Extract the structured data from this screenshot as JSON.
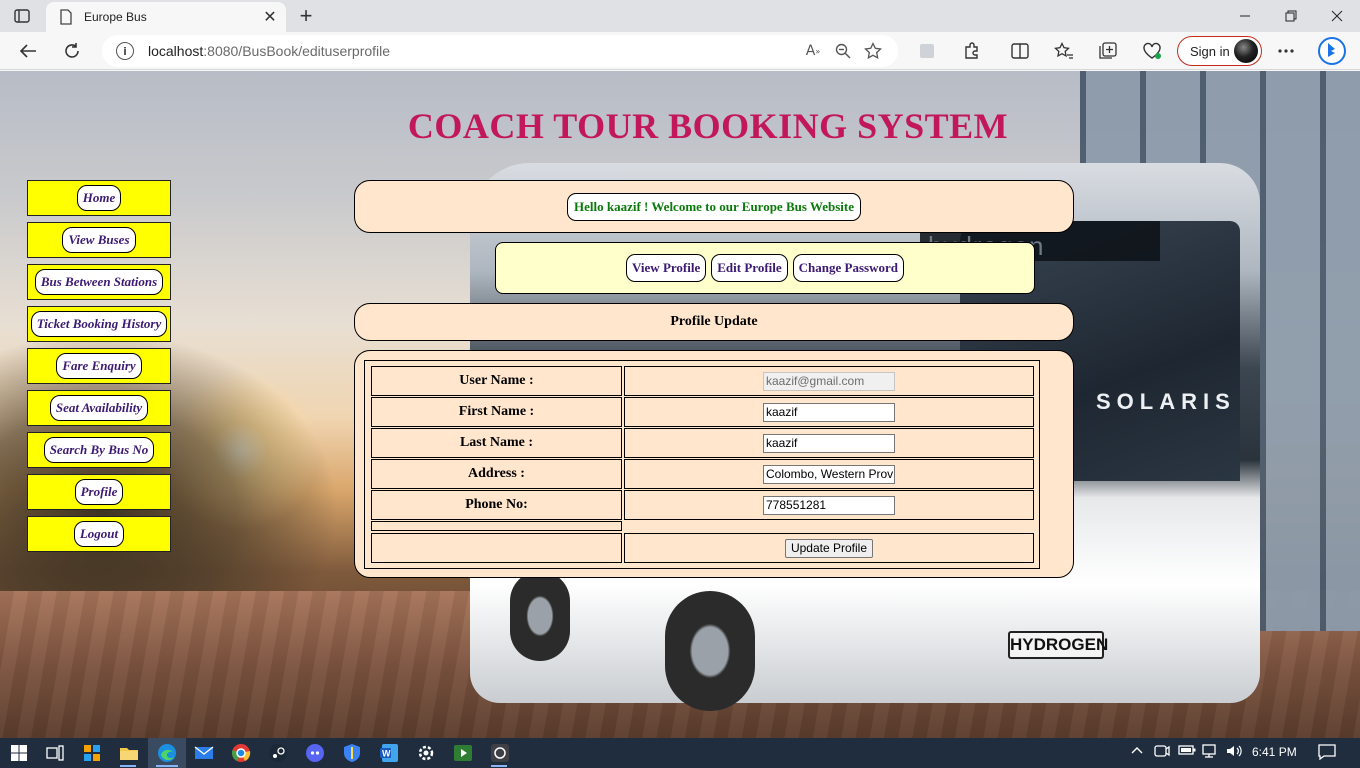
{
  "browser": {
    "tab_title": "Europe Bus",
    "tab_close": "✕",
    "new_tab": "+",
    "address_host": "localhost",
    "address_path": ":8080/BusBook/edituserprofile",
    "signin_label": "Sign in",
    "icons": [
      "tab-actions-icon",
      "back-arrow-icon",
      "refresh-icon",
      "site-info-icon",
      "read-aloud-icon",
      "zoom-out-icon",
      "favorite-star-icon",
      "extensions-icon",
      "split-screen-icon",
      "favorites-icon",
      "collections-icon",
      "browser-essentials-icon",
      "more-options-icon",
      "bing-icon"
    ]
  },
  "site": {
    "title": "COACH TOUR BOOKING SYSTEM",
    "welcome": "Hello kaazif ! Welcome to our Europe Bus Website"
  },
  "nav": {
    "items": [
      {
        "label": "Home"
      },
      {
        "label": "View Buses"
      },
      {
        "label": "Bus Between Stations"
      },
      {
        "label": "Ticket Booking History"
      },
      {
        "label": "Fare Enquiry"
      },
      {
        "label": "Seat Availability"
      },
      {
        "label": "Search By Bus No"
      },
      {
        "label": "Profile"
      },
      {
        "label": "Logout"
      }
    ],
    "colors": {
      "background": "#ffff00",
      "text": "#3c1a73"
    }
  },
  "profile_nav": {
    "view": "View Profile",
    "edit": "Edit Profile",
    "change_password": "Change Password"
  },
  "form": {
    "heading": "Profile Update",
    "fields": [
      {
        "label": "User Name :",
        "value": "kaazif@gmail.com",
        "disabled": true
      },
      {
        "label": "First Name :",
        "value": "kaazif"
      },
      {
        "label": "Last Name :",
        "value": "kaazif"
      },
      {
        "label": "Address :",
        "value": "Colombo, Western Prov"
      },
      {
        "label": "Phone No:",
        "value": "778551281"
      }
    ],
    "submit": "Update Profile"
  },
  "background_text": {
    "bus_display": "hydrogen",
    "bus_brand": "SOLARIS",
    "plate": "HYDROGEN"
  },
  "taskbar": {
    "clock": "6:41 PM",
    "icons": [
      "windows-start-icon",
      "task-view-icon",
      "widgets-icon",
      "file-explorer-icon",
      "edge-icon",
      "mail-icon",
      "chrome-icon",
      "steam-icon",
      "discord-icon",
      "security-icon",
      "word-icon",
      "settings-icon",
      "media-icon",
      "tool-icon"
    ]
  },
  "colors": {
    "title": "#c2185b",
    "panel": "#ffe6cc",
    "subnav_panel": "#ffffcc",
    "welcome_text": "#0b7a0b"
  }
}
